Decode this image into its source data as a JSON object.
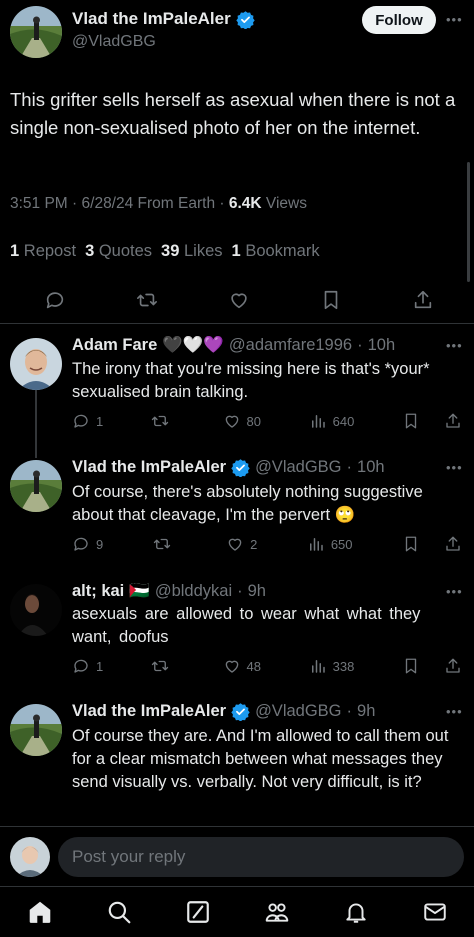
{
  "main_tweet": {
    "display_name": "Vlad the ImPaleAler",
    "handle": "@VladGBG",
    "follow_label": "Follow",
    "body": "This grifter sells herself as asexual when there is not a single non-sexualised photo of her on the internet.",
    "time": "3:51 PM",
    "date": "6/28/24",
    "source": "From Earth",
    "views_count": "6.4K",
    "views_label": "Views",
    "reposts_count": "1",
    "reposts_label": "Repost",
    "quotes_count": "3",
    "quotes_label": "Quotes",
    "likes_count": "39",
    "likes_label": "Likes",
    "bookmarks_count": "1",
    "bookmarks_label": "Bookmark"
  },
  "replies": [
    {
      "display_name": "Adam Fare",
      "emoji": "🖤🤍💜",
      "handle": "@adamfare1996",
      "time": "10h",
      "text": "The irony that you're missing here is that's *your* sexualised brain talking.",
      "replies": "1",
      "reposts": "",
      "likes": "80",
      "views": "640"
    },
    {
      "display_name": "Vlad the ImPaleAler",
      "emoji": "",
      "handle": "@VladGBG",
      "time": "10h",
      "text": "Of course, there's absolutely nothing suggestive about that cleavage, I'm the pervert 🙄",
      "replies": "9",
      "reposts": "",
      "likes": "2",
      "views": "650"
    },
    {
      "display_name": "alt; kai",
      "emoji": "🇵🇸",
      "handle": "@blddykai",
      "time": "9h",
      "text": "asexuals are allowed to wear what what they want, doofus",
      "replies": "1",
      "reposts": "",
      "likes": "48",
      "views": "338"
    },
    {
      "display_name": "Vlad the ImPaleAler",
      "emoji": "",
      "handle": "@VladGBG",
      "time": "9h",
      "text": "Of course they are. And I'm allowed to call them out for a clear mismatch between what messages they send visually vs. verbally. Not very difficult, is it?"
    }
  ],
  "composer": {
    "placeholder": "Post your reply"
  },
  "nav": [
    "home-icon",
    "search-icon",
    "grok-icon",
    "communities-icon",
    "notifications-icon",
    "messages-icon"
  ],
  "colors": {
    "background": "#000000",
    "text": "#e7e9ea",
    "muted": "#71767b",
    "verified": "#1d9bf0",
    "divider": "#2f3336"
  }
}
